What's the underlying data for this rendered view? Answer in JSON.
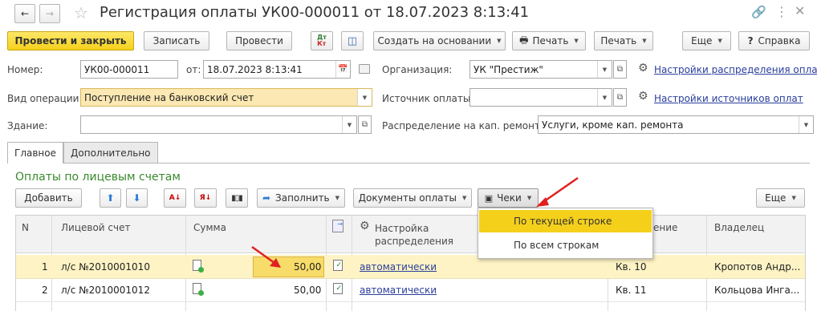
{
  "window": {
    "title": "Регистрация оплаты УК00-000011 от 18.07.2023 8:13:41"
  },
  "toolbar": {
    "post_close": "Провести и закрыть",
    "save": "Записать",
    "post": "Провести",
    "create_based": "Создать на основании",
    "print_icon_label": "Печать",
    "print": "Печать",
    "more": "Еще",
    "help": "Справка",
    "dt_kt": "Дт",
    "kt": "Кт"
  },
  "form": {
    "number_label": "Номер:",
    "number_value": "УК00-000011",
    "date_label": "от:",
    "date_value": "18.07.2023  8:13:41",
    "org_label": "Организация:",
    "org_value": "УК \"Престиж\"",
    "dist_settings_link": "Настройки распределения оплат",
    "op_label": "Вид операции:",
    "op_value": "Поступление на банковский счет",
    "source_label": "Источник оплаты:",
    "source_value": "",
    "source_settings_link": "Настройки источников оплат",
    "building_label": "Здание:",
    "building_value": "",
    "capdist_label": "Распределение на кап. ремонт:",
    "capdist_value": "Услуги, кроме кап. ремонта"
  },
  "tabs": [
    {
      "label": "Главное"
    },
    {
      "label": "Дополнительно"
    }
  ],
  "section": {
    "title": "Оплаты по лицевым счетам"
  },
  "table_toolbar": {
    "add": "Добавить",
    "fill": "Заполнить",
    "payment_docs": "Документы оплаты",
    "checks": "Чеки",
    "more": "Еще"
  },
  "dropdown": {
    "items": [
      "По текущей строке",
      "По всем строкам"
    ]
  },
  "table": {
    "headers": {
      "n": "N",
      "account": "Лицевой счет",
      "sum": "Сумма",
      "dist_line1": "Настройка",
      "dist_line2": "распределения",
      "premise_partial": "ение",
      "owner": "Владелец"
    },
    "rows": [
      {
        "n": "1",
        "account": "л/с №2010001010",
        "sum": "50,00",
        "dist": "автоматически",
        "premise": "Кв. 10",
        "owner": "Кропотов Андр..."
      },
      {
        "n": "2",
        "account": "л/с №2010001012",
        "sum": "50,00",
        "dist": "автоматически",
        "premise": "Кв. 11",
        "owner": "Кольцова Инга..."
      }
    ]
  },
  "colors": {
    "accent_yellow": "#f5d01b",
    "row_highlight": "#fdf3c4",
    "link": "#2a3e9c",
    "section_green": "#3a8a2e",
    "arrow_red": "#e02020"
  }
}
